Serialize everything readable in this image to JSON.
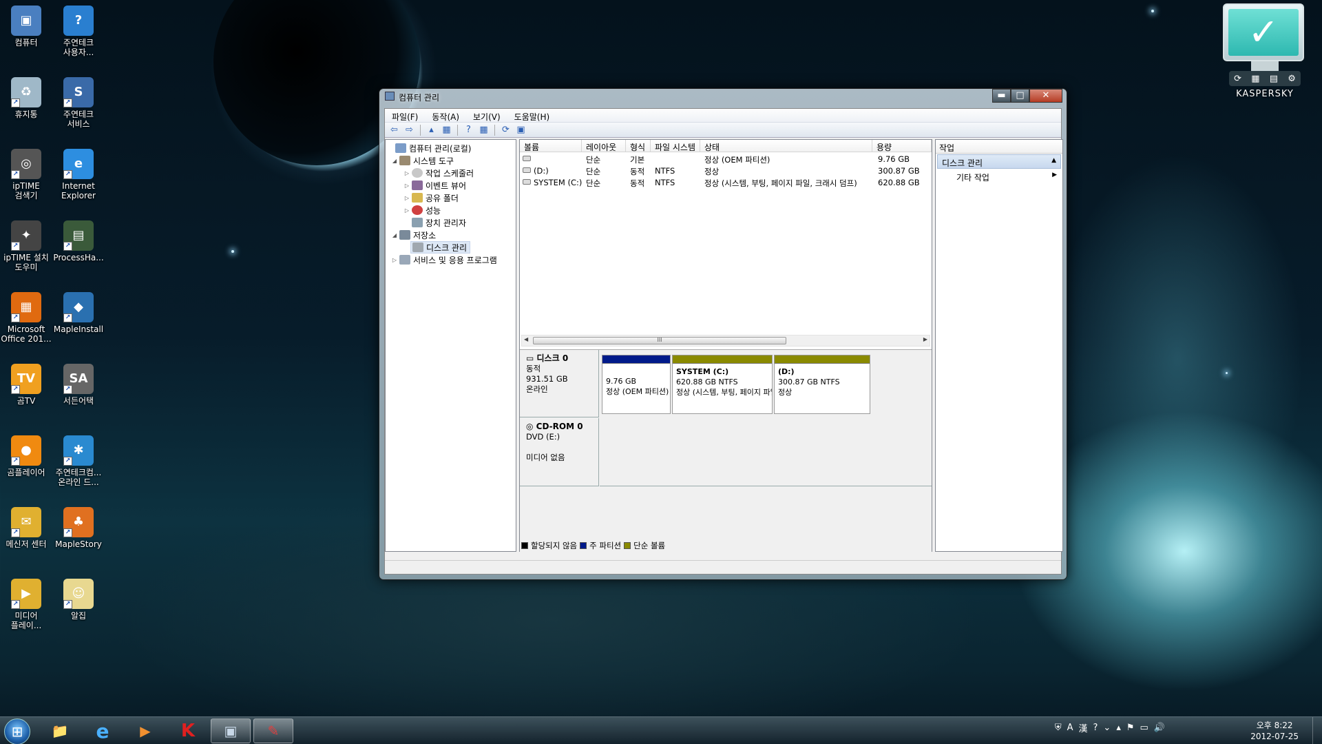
{
  "desktop": {
    "icons": [
      {
        "label": "컴퓨터",
        "color": "#4a7fc0",
        "glyph": "▣"
      },
      {
        "label": "주연테크\n사용자...",
        "color": "#2a7fd0",
        "glyph": "?"
      },
      {
        "label": "휴지통",
        "color": "#9fb8c8",
        "glyph": "♻"
      },
      {
        "label": "주연테크\n서비스",
        "color": "#3a6aa8",
        "glyph": "S"
      },
      {
        "label": "ipTIME\n검색기",
        "color": "#555",
        "glyph": "◎"
      },
      {
        "label": "Internet\nExplorer",
        "color": "#2d8ee0",
        "glyph": "e"
      },
      {
        "label": "ipTIME 설치\n도우미",
        "color": "#444",
        "glyph": "✦"
      },
      {
        "label": "ProcessHa...",
        "color": "#3a5a3a",
        "glyph": "▤"
      },
      {
        "label": "Microsoft\nOffice 201...",
        "color": "#e06a10",
        "glyph": "▦"
      },
      {
        "label": "MapleInstall",
        "color": "#2a70b0",
        "glyph": "◆"
      },
      {
        "label": "곰TV",
        "color": "#f0a020",
        "glyph": "TV"
      },
      {
        "label": "서든어택",
        "color": "#666",
        "glyph": "SA"
      },
      {
        "label": "곰플레이어",
        "color": "#f08a10",
        "glyph": "●"
      },
      {
        "label": "주연테크컴...\n온라인 드...",
        "color": "#2a8ad0",
        "glyph": "✱"
      },
      {
        "label": "메신저 센터",
        "color": "#e0b030",
        "glyph": "✉"
      },
      {
        "label": "MapleStory",
        "color": "#e07020",
        "glyph": "♣"
      },
      {
        "label": "미디어\n플레이...",
        "color": "#e0b030",
        "glyph": "▶"
      },
      {
        "label": "알집",
        "color": "#e8d890",
        "glyph": "☺"
      }
    ]
  },
  "gadget": {
    "brand": "KASPERSKY",
    "check": "✓",
    "buttons": [
      "⟳",
      "▦",
      "▤",
      "⚙"
    ]
  },
  "window": {
    "title": "컴퓨터 관리",
    "buttons": {
      "minimize": "▬",
      "maximize": "□",
      "close": "✕"
    },
    "menu": [
      "파일(F)",
      "동작(A)",
      "보기(V)",
      "도움말(H)"
    ],
    "toolbar": [
      "⇦",
      "⇨",
      "▴",
      "▦",
      "?",
      "▦",
      "⟳",
      "▣"
    ],
    "tree": {
      "root": "컴퓨터 관리(로컬)",
      "system_tools": "시스템 도구",
      "task_scheduler": "작업 스케줄러",
      "event_viewer": "이벤트 뷰어",
      "shared_folders": "공유 폴더",
      "performance": "성능",
      "device_manager": "장치 관리자",
      "storage": "저장소",
      "disk_management": "디스크 관리",
      "services": "서비스 및 응용 프로그램"
    },
    "list": {
      "columns": [
        "볼륨",
        "레이아웃",
        "형식",
        "파일 시스템",
        "상태",
        "용량"
      ],
      "rows": [
        {
          "volume": "",
          "layout": "단순",
          "type": "기본",
          "fs": "",
          "status": "정상 (OEM 파티션)",
          "capacity": "9.76 GB"
        },
        {
          "volume": "(D:)",
          "layout": "단순",
          "type": "동적",
          "fs": "NTFS",
          "status": "정상",
          "capacity": "300.87 GB"
        },
        {
          "volume": "SYSTEM (C:)",
          "layout": "단순",
          "type": "동적",
          "fs": "NTFS",
          "status": "정상 (시스템, 부팅, 페이지 파일, 크래시 덤프)",
          "capacity": "620.88 GB"
        }
      ],
      "scroll_thumb": "III"
    },
    "disks": {
      "disk0": {
        "name": "디스크 0",
        "kind": "동적",
        "size": "931.51 GB",
        "state": "온라인"
      },
      "partitions": [
        {
          "name": "",
          "size": "9.76 GB",
          "status": "정상 (OEM 파티션)",
          "bar": "#001a8a"
        },
        {
          "name": "SYSTEM  (C:)",
          "size": "620.88 GB NTFS",
          "status": "정상 (시스템, 부팅, 페이지 파일",
          "bar": "#8a8a00"
        },
        {
          "name": "(D:)",
          "size": "300.87 GB NTFS",
          "status": "정상",
          "bar": "#8a8a00"
        }
      ],
      "cdrom": {
        "name": "CD-ROM 0",
        "drive": "DVD (E:)",
        "state": "미디어 없음"
      },
      "legend": [
        {
          "label": "할당되지 않음",
          "color": "#000000"
        },
        {
          "label": "주 파티션",
          "color": "#001a8a"
        },
        {
          "label": "단순 볼륨",
          "color": "#8a8a00"
        }
      ]
    },
    "actions": {
      "header": "작업",
      "section": "디스크 관리",
      "item": "기타 작업"
    }
  },
  "taskbar": {
    "start": "⊞",
    "apps": [
      "📁",
      "e",
      "▶",
      "K",
      "▣",
      "✎"
    ],
    "tray": [
      "⛨",
      "A",
      "漢",
      "?",
      "⌄",
      "▴",
      "⚑",
      "▭",
      "🔊"
    ],
    "time": "오후 8:22",
    "date": "2012-07-25"
  }
}
